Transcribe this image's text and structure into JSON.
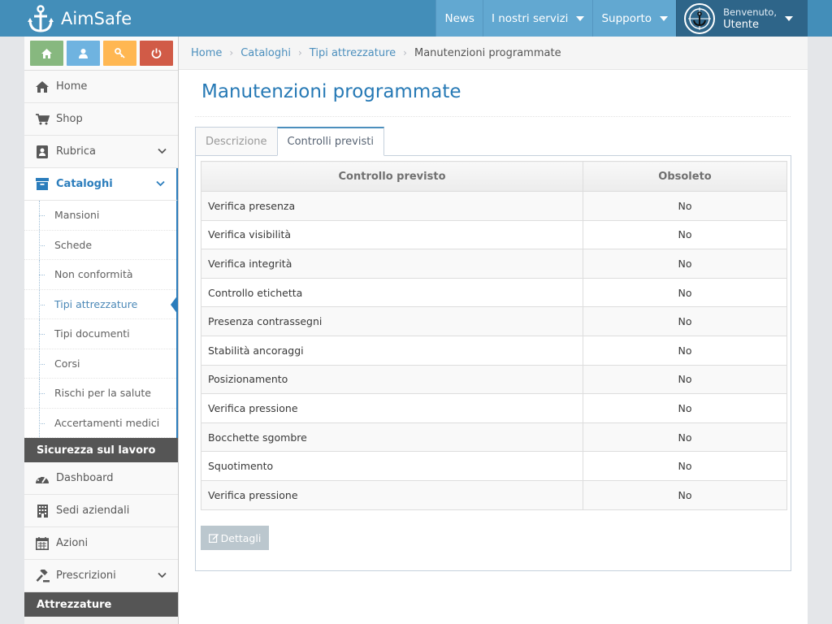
{
  "app": {
    "title": "AimSafe"
  },
  "navbar": {
    "items": [
      {
        "label": "News",
        "dropdown": false
      },
      {
        "label": "I nostri servizi",
        "dropdown": true
      },
      {
        "label": "Supporto",
        "dropdown": true
      }
    ],
    "user": {
      "welcome": "Benvenuto,",
      "name": "Utente"
    }
  },
  "sidebar": {
    "shortcuts": [
      {
        "icon": "home-icon",
        "color": "#87b87f"
      },
      {
        "icon": "user-icon",
        "color": "#6fb3e0"
      },
      {
        "icon": "key-icon",
        "color": "#ffb752"
      },
      {
        "icon": "power-icon",
        "color": "#d15b47"
      }
    ],
    "items": [
      {
        "label": "Home",
        "icon": "home-icon"
      },
      {
        "label": "Shop",
        "icon": "cart-icon"
      },
      {
        "label": "Rubrica",
        "icon": "address-book-icon"
      },
      {
        "label": "Cataloghi",
        "icon": "archive-icon"
      }
    ],
    "submenu": [
      "Mansioni",
      "Schede",
      "Non conformità",
      "Tipi attrezzature",
      "Tipi documenti",
      "Corsi",
      "Rischi per la salute",
      "Accertamenti medici"
    ],
    "active_sub": "Tipi attrezzature",
    "section1": "Sicurezza sul lavoro",
    "items2": [
      {
        "label": "Dashboard",
        "icon": "dashboard-icon"
      },
      {
        "label": "Sedi aziendali",
        "icon": "building-icon"
      },
      {
        "label": "Azioni",
        "icon": "calendar-icon"
      },
      {
        "label": "Prescrizioni",
        "icon": "gavel-icon"
      }
    ],
    "section2": "Attrezzature"
  },
  "breadcrumb": [
    "Home",
    "Cataloghi",
    "Tipi attrezzature",
    "Manutenzioni programmate"
  ],
  "page": {
    "title": "Manutenzioni programmate"
  },
  "tabs": [
    "Descrizione",
    "Controlli previsti"
  ],
  "active_tab": "Controlli previsti",
  "table": {
    "headers": [
      "Controllo previsto",
      "Obsoleto"
    ],
    "rows": [
      [
        "Verifica presenza",
        "No"
      ],
      [
        "Verifica visibilità",
        "No"
      ],
      [
        "Verifica integrità",
        "No"
      ],
      [
        "Controllo etichetta",
        "No"
      ],
      [
        "Presenza contrassegni",
        "No"
      ],
      [
        "Stabilità ancoraggi",
        "No"
      ],
      [
        "Posizionamento",
        "No"
      ],
      [
        "Verifica pressione",
        "No"
      ],
      [
        "Bocchette sgombre",
        "No"
      ],
      [
        "Squotimento",
        "No"
      ],
      [
        "Verifica pressione",
        "No"
      ]
    ]
  },
  "buttons": {
    "details": "Dettagli"
  }
}
